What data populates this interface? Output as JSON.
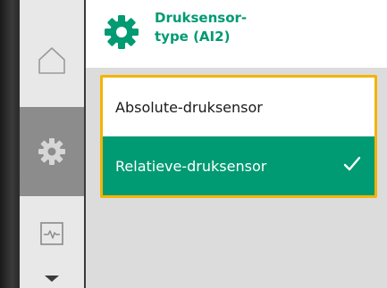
{
  "header": {
    "title": "Druksensor-\ntype (AI2)",
    "icon": "gear-icon",
    "accent_color": "#009a73"
  },
  "sidebar": {
    "items": [
      {
        "name": "home",
        "icon": "home-icon",
        "selected": false
      },
      {
        "name": "settings",
        "icon": "gear-icon",
        "selected": true
      },
      {
        "name": "diagnostics",
        "icon": "pulse-monitor-icon",
        "selected": false
      }
    ],
    "more_indicator": "chevron-down-icon"
  },
  "options": {
    "absolute_label": "Absolute-druksensor",
    "relative_label": "Relatieve-druksensor",
    "selected": "Relatieve-druksensor"
  },
  "colors": {
    "focus_border": "#f4b400",
    "selected_row": "#009a73",
    "rail_selected": "#8c8c8c"
  }
}
